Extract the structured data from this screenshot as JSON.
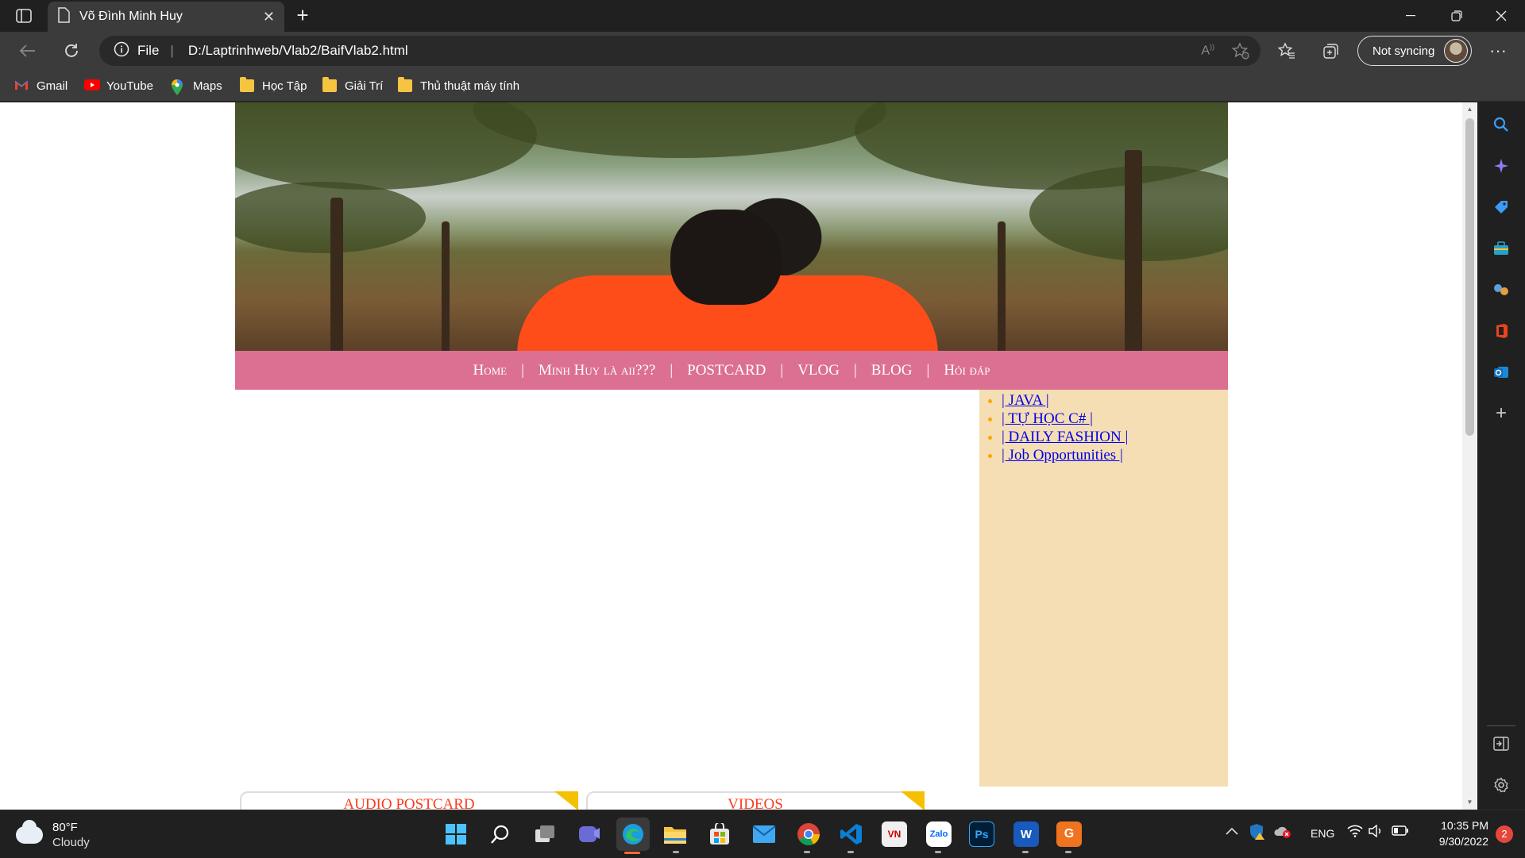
{
  "browser": {
    "tab_title": "Võ Đình Minh Huy",
    "address_prefix": "File",
    "address_url": "D:/Laptrinhweb/Vlab2/BaifVlab2.html",
    "sync_label": "Not syncing",
    "new_tab_glyph": "+",
    "close_tab_glyph": "✕"
  },
  "bookmarks": [
    {
      "label": "Gmail",
      "icon": "gmail-icon"
    },
    {
      "label": "YouTube",
      "icon": "youtube-icon"
    },
    {
      "label": "Maps",
      "icon": "maps-icon"
    },
    {
      "label": "Học Tập",
      "icon": "folder-icon"
    },
    {
      "label": "Giải Trí",
      "icon": "folder-icon"
    },
    {
      "label": "Thủ thuật máy tính",
      "icon": "folder-icon"
    }
  ],
  "page": {
    "nav": [
      "Home",
      "Minh Huy là aii???",
      "POSTCARD",
      "VLOG",
      "BLOG",
      "Hỏi đáp"
    ],
    "nav_separator": "|",
    "aside_links": [
      "| JAVA |",
      "| TỰ HỌC C# |",
      "| DAILY FASHION |",
      "| Job Opportunities |"
    ],
    "cards": [
      "AUDIO POSTCARD",
      "VIDEOS"
    ],
    "colors": {
      "nav_bg": "#dc7093",
      "aside_bg": "#f5deb3",
      "card_label": "#ff3b1f",
      "bullet": "#ffa500"
    }
  },
  "taskbar": {
    "weather_temp": "80°F",
    "weather_desc": "Cloudy",
    "lang": "ENG",
    "time": "10:35 PM",
    "date": "9/30/2022",
    "notification_count": "2"
  }
}
